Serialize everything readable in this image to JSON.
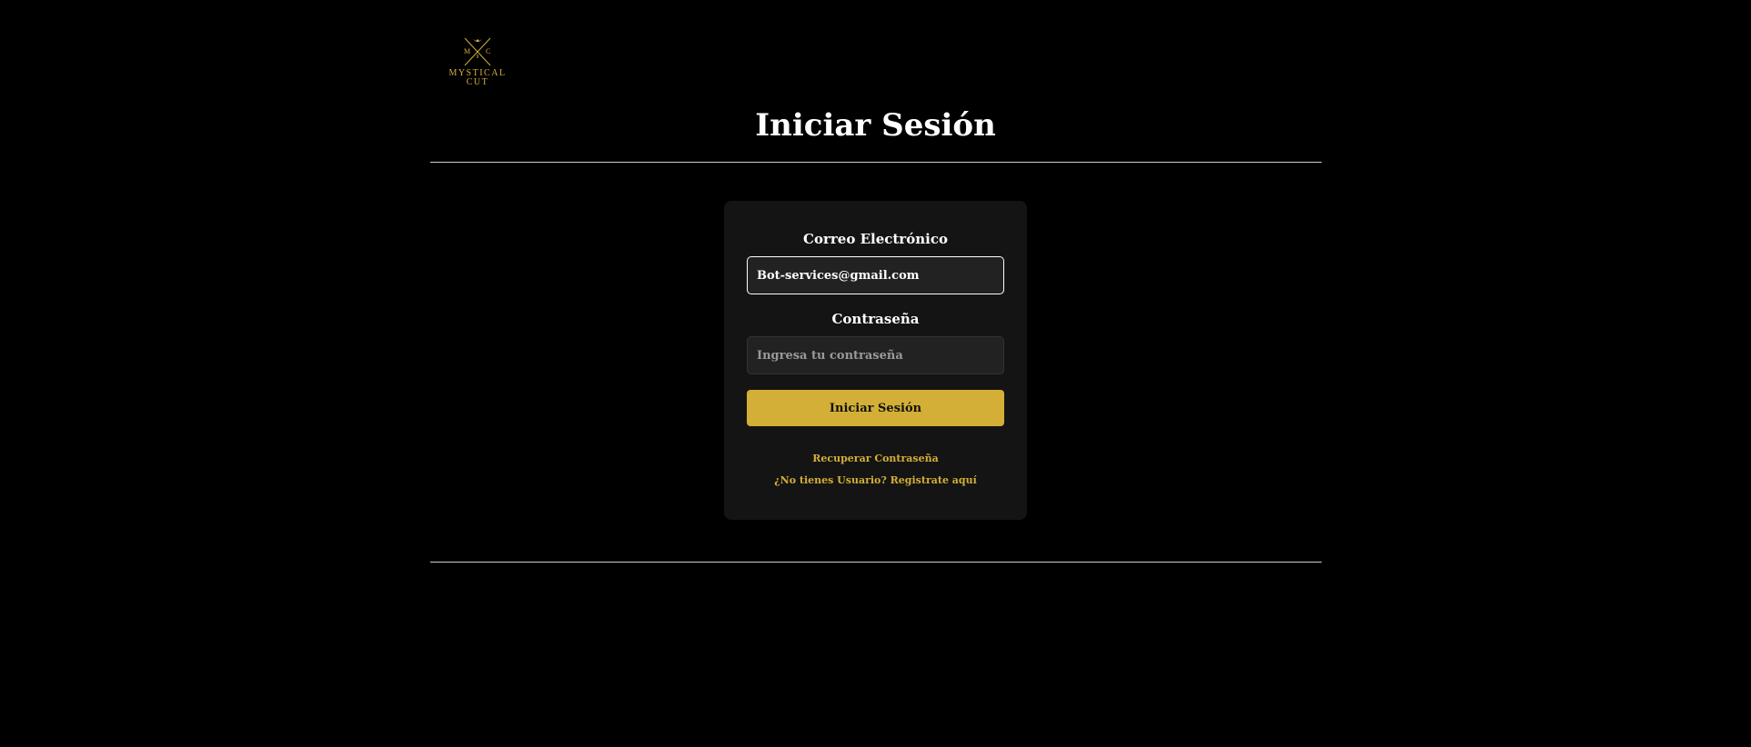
{
  "brand": {
    "logo_text_line1": "MYSTICAL",
    "logo_text_line2": "CUT",
    "logo_monogram_left": "M",
    "logo_monogram_right": "C",
    "accent_color": "#d4af37"
  },
  "header": {
    "title": "Iniciar Sesión"
  },
  "login_form": {
    "email_label": "Correo Electrónico",
    "email_value": "Bot-services@gmail.com",
    "password_label": "Contraseña",
    "password_placeholder": "Ingresa tu contraseña",
    "password_value": "",
    "submit_label": "Iniciar Sesión",
    "recover_link": "Recuperar Contraseña",
    "register_link": "¿No tienes Usuario? Registrate aquí"
  }
}
